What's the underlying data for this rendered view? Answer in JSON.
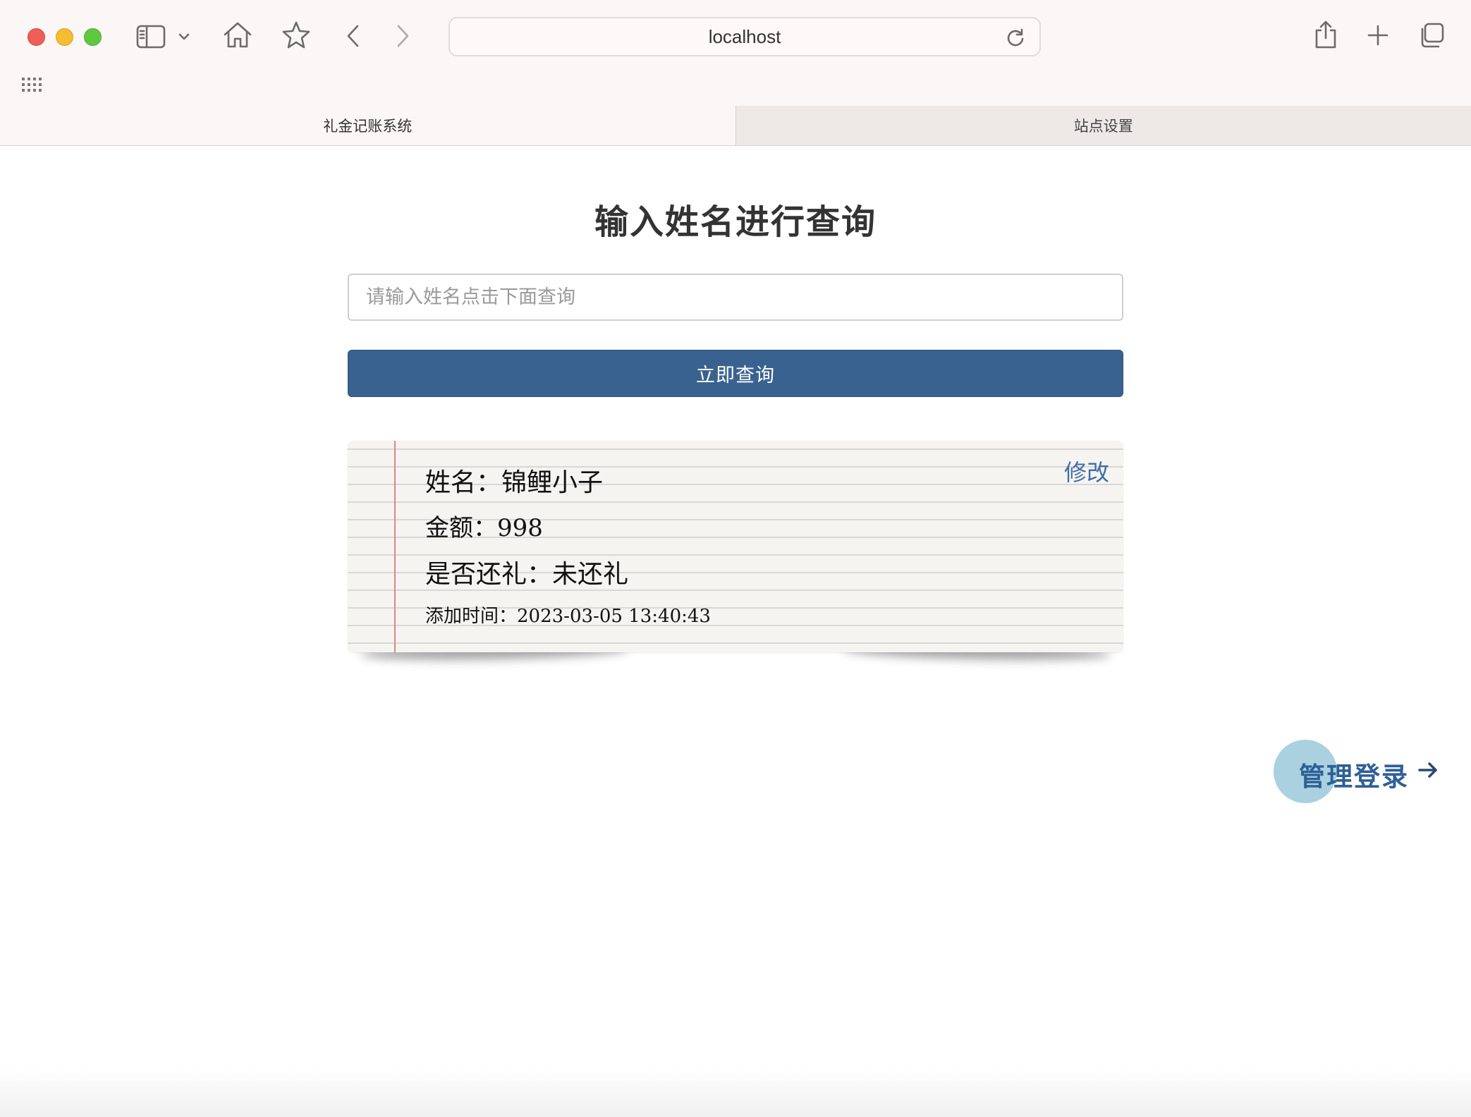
{
  "browser": {
    "url": "localhost"
  },
  "tabs": [
    {
      "label": "礼金记账系统",
      "active": true
    },
    {
      "label": "站点设置",
      "active": false
    }
  ],
  "main": {
    "title": "输入姓名进行查询",
    "search": {
      "placeholder": "请输入姓名点击下面查询",
      "value": ""
    },
    "query_button": "立即查询",
    "record": {
      "name_label": "姓名：",
      "name_value": "锦鲤小子",
      "amount_label": "金额：",
      "amount_value": "998",
      "returned_label": "是否还礼：",
      "returned_value": "未还礼",
      "time_label": "添加时间：",
      "time_value": "2023-03-05 13:40:43",
      "edit_label": "修改"
    },
    "admin_login": "管理登录"
  },
  "colors": {
    "primary_button": "#3a6290",
    "link": "#3f6ea6",
    "admin_circle": "#a9d1e0",
    "margin_line": "#d28a8a"
  },
  "icons": [
    "sidebar-icon",
    "chevron-down-icon",
    "home-icon",
    "star-icon",
    "back-icon",
    "forward-icon",
    "reload-icon",
    "share-icon",
    "new-tab-icon",
    "tab-overview-icon",
    "apps-grid-icon",
    "arrow-right-icon"
  ]
}
